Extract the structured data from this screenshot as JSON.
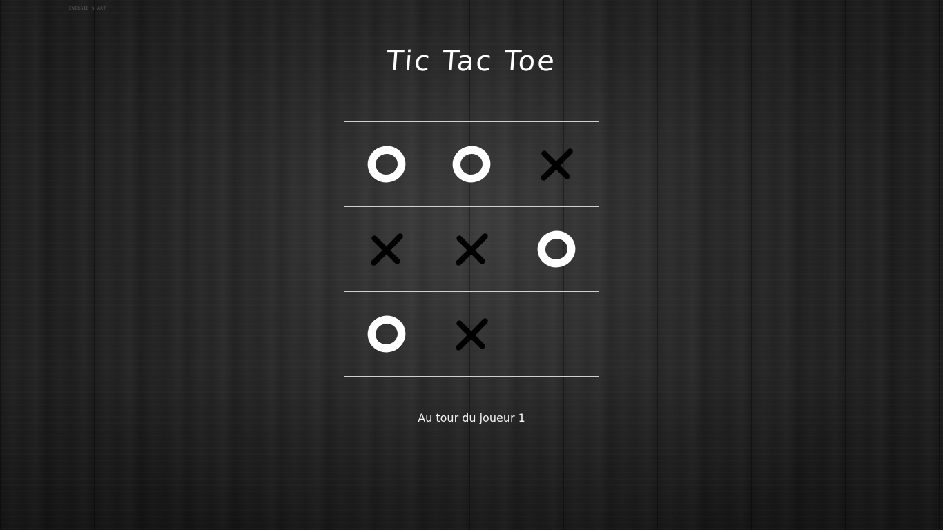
{
  "watermark": "ENERGIE'S ART",
  "title": "Tic Tac Toe",
  "board": {
    "cells": [
      "O",
      "O",
      "X",
      "X",
      "X",
      "O",
      "O",
      "X",
      ""
    ]
  },
  "status": "Au tour du joueur 1",
  "colors": {
    "o_mark": "#ffffff",
    "x_mark": "#000000",
    "grid_line": "#cfcfcf"
  },
  "icons": {
    "o": "o-mark-icon",
    "x": "x-mark-icon"
  }
}
